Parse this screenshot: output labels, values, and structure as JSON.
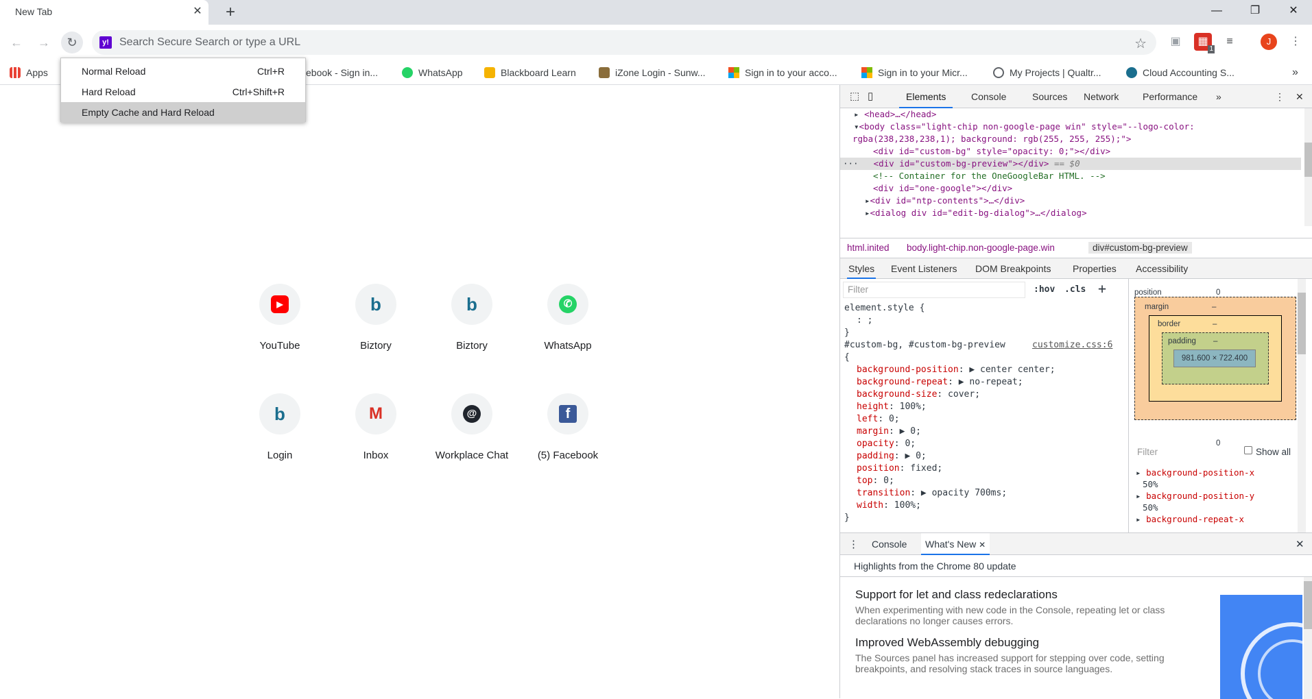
{
  "tab": {
    "title": "New Tab",
    "close": "✕",
    "new": "+"
  },
  "window": {
    "minimize": "—",
    "restore": "❐",
    "close": "✕"
  },
  "omnibox": {
    "placeholder": "Search Secure Search or type a URL",
    "engine_icon": "y!"
  },
  "extensions": {
    "badge": "1",
    "avatar": "J"
  },
  "bookmarks": [
    {
      "label": "Apps",
      "icon": "apps-grid-icon",
      "color": "#e94235"
    },
    {
      "label": "ebook - Sign in...",
      "icon": "facebook-icon",
      "color": "#3b5998"
    },
    {
      "label": "WhatsApp",
      "icon": "whatsapp-icon",
      "color": "#25d366"
    },
    {
      "label": "Blackboard Learn",
      "icon": "pencil-icon",
      "color": "#f5b301"
    },
    {
      "label": "iZone Login - Sunw...",
      "icon": "crest-icon",
      "color": "#8a6d3b"
    },
    {
      "label": "Sign in to your acco...",
      "icon": "microsoft-icon",
      "color": "#f25022"
    },
    {
      "label": "Sign in to your Micr...",
      "icon": "microsoft-icon",
      "color": "#7fba00"
    },
    {
      "label": "My Projects | Qualtr...",
      "icon": "globe-icon",
      "color": "#5f6368"
    },
    {
      "label": "Cloud Accounting S...",
      "icon": "biztory-icon",
      "color": "#1a6e8e"
    }
  ],
  "reload_menu": [
    {
      "label": "Normal Reload",
      "shortcut": "Ctrl+R"
    },
    {
      "label": "Hard Reload",
      "shortcut": "Ctrl+Shift+R"
    },
    {
      "label": "Empty Cache and Hard Reload",
      "shortcut": ""
    }
  ],
  "shortcuts": [
    {
      "label": "YouTube",
      "icon": "youtube-icon",
      "glyph": "▶",
      "color": "#ff0000"
    },
    {
      "label": "Biztory",
      "icon": "biztory-icon",
      "glyph": "b",
      "color": "#1a6e8e"
    },
    {
      "label": "Biztory",
      "icon": "biztory-icon",
      "glyph": "b",
      "color": "#1a6e8e"
    },
    {
      "label": "WhatsApp",
      "icon": "whatsapp-icon",
      "glyph": "✆",
      "color": "#25d366"
    },
    {
      "label": "Login",
      "icon": "biztory-icon",
      "glyph": "b",
      "color": "#1a6e8e"
    },
    {
      "label": "Inbox",
      "icon": "gmail-icon",
      "glyph": "M",
      "color": "#d93025"
    },
    {
      "label": "Workplace Chat",
      "icon": "workplace-chat-icon",
      "glyph": "@",
      "color": "#20252d"
    },
    {
      "label": "(5) Facebook",
      "icon": "facebook-icon",
      "glyph": "f",
      "color": "#3b5998"
    }
  ],
  "devtools": {
    "tabs": [
      "Elements",
      "Console",
      "Sources",
      "Network",
      "Performance",
      "»"
    ],
    "dom": {
      "head": "<head>…</head>",
      "body_open": "<body class=\"light-chip non-google-page win\" style=\"--logo-color:",
      "body_cont": "rgba(238,238,238,1); background: rgb(255, 255, 255);\">",
      "custom_bg": "<div id=\"custom-bg\" style=\"opacity: 0;\"></div>",
      "custom_bg_preview": "<div id=\"custom-bg-preview\"></div>",
      "selected_marker": "== $0",
      "comment": "<!-- Container for the OneGoogleBar HTML. -->",
      "one_google": "<div id=\"one-google\"></div>",
      "ntp_contents": "<div id=\"ntp-contents\">…</div>",
      "dialog": "<dialog div id=\"edit-bg-dialog\">…</dialog>"
    },
    "breadcrumbs": [
      "html.inited",
      "body.light-chip.non-google-page.win",
      "div#custom-bg-preview"
    ],
    "subtabs": [
      "Styles",
      "Event Listeners",
      "DOM Breakpoints",
      "Properties",
      "Accessibility"
    ],
    "styles": {
      "filter_placeholder": "Filter",
      "hov": ":hov",
      "cls": ".cls",
      "element_style": "element.style {",
      "element_style_body": ": ;",
      "close_brace": "}",
      "rule_selector": "#custom-bg, #custom-bg-preview",
      "rule_source": "customize.css:6",
      "open_brace": "{",
      "declarations": [
        {
          "prop": "background-position",
          "value": "▶ center center;"
        },
        {
          "prop": "background-repeat",
          "value": "▶ no-repeat;"
        },
        {
          "prop": "background-size",
          "value": "cover;"
        },
        {
          "prop": "height",
          "value": "100%;"
        },
        {
          "prop": "left",
          "value": "0;"
        },
        {
          "prop": "margin",
          "value": "▶ 0;"
        },
        {
          "prop": "opacity",
          "value": "0;"
        },
        {
          "prop": "padding",
          "value": "▶ 0;"
        },
        {
          "prop": "position",
          "value": "fixed;"
        },
        {
          "prop": "top",
          "value": "0;"
        },
        {
          "prop": "transition",
          "value": "▶ opacity 700ms;"
        },
        {
          "prop": "width",
          "value": "100%;"
        }
      ]
    },
    "box_model": {
      "position_label": "position",
      "position_value": "0",
      "margin_label": "margin",
      "border_label": "border",
      "padding_label": "padding",
      "dash": "–",
      "content": "981.600 × 722.400",
      "zero": "0"
    },
    "computed": {
      "filter_placeholder": "Filter",
      "show_all": "Show all",
      "props": [
        {
          "name": "background-position-x",
          "value": "50%"
        },
        {
          "name": "background-position-y",
          "value": "50%"
        },
        {
          "name": "background-repeat-x",
          "value": ""
        }
      ]
    },
    "drawer": {
      "tabs": [
        "Console",
        "What's New"
      ],
      "heading": "Highlights from the Chrome 80 update",
      "items": [
        {
          "title": "Support for let and class redeclarations",
          "desc": "When experimenting with new code in the Console, repeating let or class declarations no longer causes errors."
        },
        {
          "title": "Improved WebAssembly debugging",
          "desc": "The Sources panel has increased support for stepping over code, setting breakpoints, and resolving stack traces in source languages."
        }
      ]
    }
  }
}
